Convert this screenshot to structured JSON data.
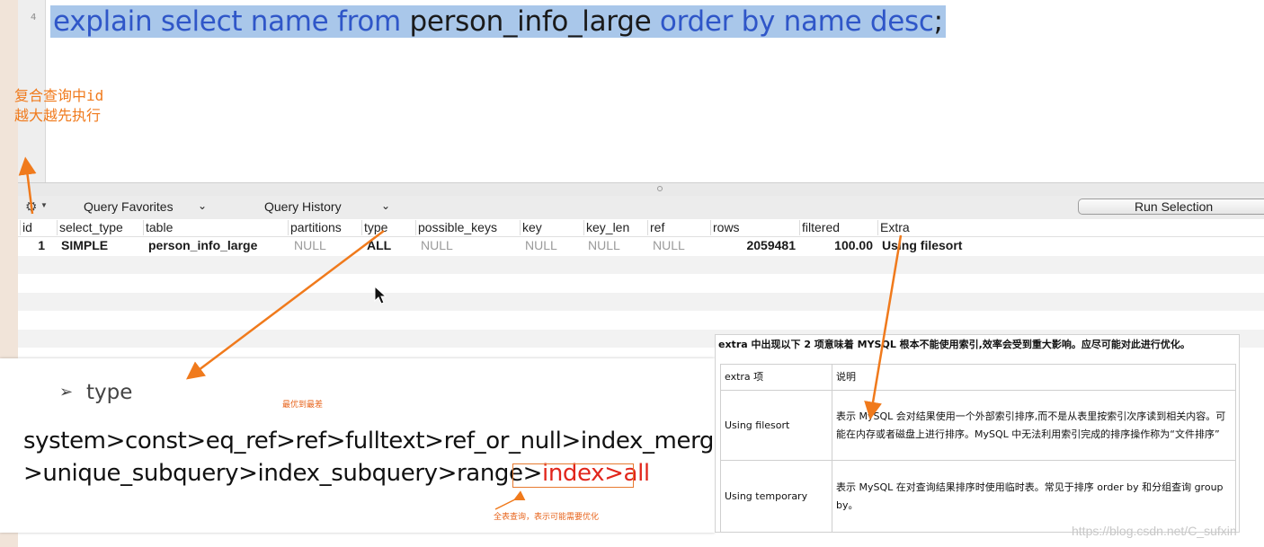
{
  "editor": {
    "line_number": "4",
    "sql_tokens": [
      {
        "t": "explain select name from ",
        "kw": true
      },
      {
        "t": "person_info_large",
        "kw": false
      },
      {
        "t": " order by name desc",
        "kw": true
      },
      {
        "t": ";",
        "kw": false
      }
    ]
  },
  "annotation_left": {
    "line1": "复合查询中id",
    "line2": "越大越先执行"
  },
  "toolbar": {
    "query_favorites": "Query Favorites",
    "query_history": "Query History",
    "run_selection": "Run Selection",
    "gear_icon": "gear-icon",
    "caret": "⌄"
  },
  "results": {
    "columns": [
      "id",
      "select_type",
      "table",
      "partitions",
      "type",
      "possible_keys",
      "key",
      "key_len",
      "ref",
      "rows",
      "filtered",
      "Extra"
    ],
    "row": {
      "id": "1",
      "select_type": "SIMPLE",
      "table": "person_info_large",
      "partitions": "NULL",
      "type": "ALL",
      "possible_keys": "NULL",
      "key": "NULL",
      "key_len": "NULL",
      "ref": "NULL",
      "rows": "2059481",
      "filtered": "100.00",
      "extra": "Using filesort"
    }
  },
  "type_card": {
    "bullet": "➢",
    "title": "type",
    "note_top": "最优到最差",
    "line1": "system>const>eq_ref>ref>fulltext>ref_or_null>index_merge",
    "line2_prefix": ">unique_subquery>index_subquery>range>",
    "line2_index": "index",
    "line2_gt": ">",
    "line2_all": "all",
    "note_bottom": "全表查询，表示可能需要优化"
  },
  "extra_card": {
    "heading": "extra 中出现以下 2 项意味着 MYSQL 根本不能使用索引,效率会受到重大影响。应尽可能对此进行优化。",
    "col1_header": "extra 项",
    "col2_header": "说明",
    "rows": [
      {
        "item": "Using filesort",
        "desc": "表示 MySQL 会对结果使用一个外部索引排序,而不是从表里按索引次序读到相关内容。可能在内存或者磁盘上进行排序。MySQL 中无法利用索引完成的排序操作称为“文件排序”"
      },
      {
        "item": "Using temporary",
        "desc": "表示 MySQL 在对查询结果排序时使用临时表。常见于排序 order by 和分组查询 group by。"
      }
    ]
  },
  "watermark": "https://blog.csdn.net/C_sufxin",
  "colors": {
    "accent": "#f07a1c",
    "highlight": "#a9c7ea",
    "keyword": "#2f56c8",
    "red": "#e1261c"
  }
}
